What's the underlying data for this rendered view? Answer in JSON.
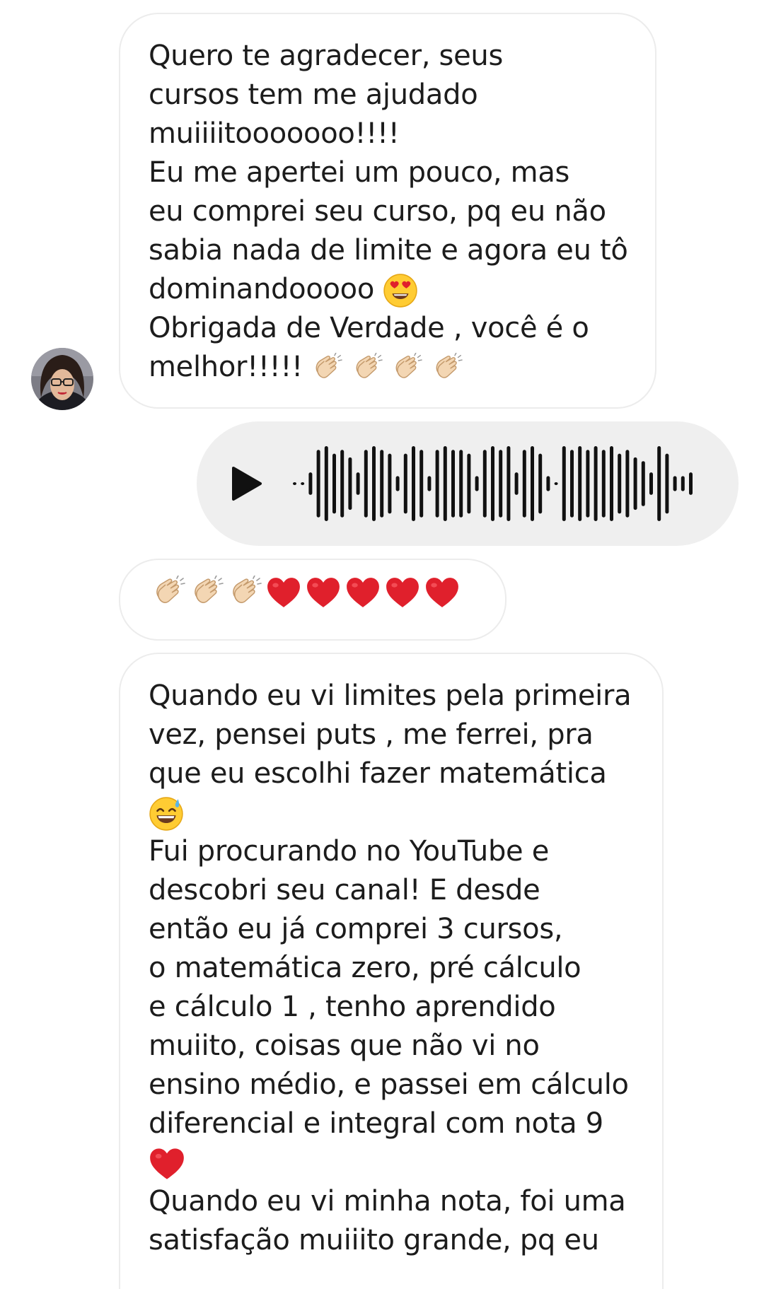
{
  "messages": {
    "thanks_text": "Quero te agradecer, seus\ncursos tem me ajudado\nmuiiiitooooooo!!!!\nEu me apertei um pouco, mas\neu comprei seu curso, pq eu não\nsabia nada de limite e agora eu tô\ndominandooooo",
    "thanks_text_2": "Obrigada de Verdade , você é o\nmelhor!!!!!",
    "limits_text_1": "Quando eu vi limites pela primeira\nvez, pensei puts , me ferrei, pra\nque eu escolhi fazer matemática",
    "limits_text_2": "Fui procurando no YouTube e\ndescobri seu canal! E desde\nentão eu já comprei 3 cursos,\no matemática zero, pré cálculo\ne cálculo 1 , tenho aprendido\nmuiito, coisas que não vi no\nensino médio, e passei em cálculo\ndiferencial e integral com nota 9",
    "limits_text_3": "Quando eu vi minha nota, foi uma\nsatisfação muiiito grande, pq eu"
  },
  "icons": {
    "play": "play-icon",
    "clap": "clapping-hands-emoji",
    "heart": "red-heart-emoji",
    "heart_eyes": "heart-eyes-emoji",
    "sweat_smile": "grinning-sweat-emoji"
  },
  "colors": {
    "incoming_border": "#ececec",
    "voice_bg": "#efefef",
    "waveform": "#111111",
    "heart": "#e0202c",
    "clap": "#f3d6b3"
  }
}
